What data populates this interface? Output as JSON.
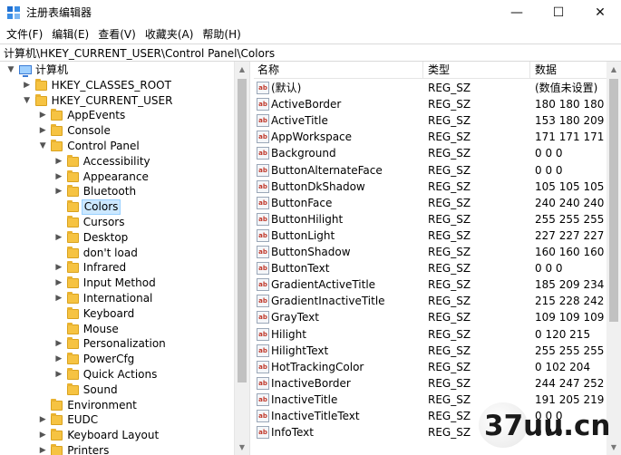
{
  "window": {
    "title": "注册表编辑器",
    "minimize_glyph": "—",
    "maximize_glyph": "☐",
    "close_glyph": "✕"
  },
  "menu": [
    "文件(F)",
    "编辑(E)",
    "查看(V)",
    "收藏夹(A)",
    "帮助(H)"
  ],
  "address": "计算机\\HKEY_CURRENT_USER\\Control Panel\\Colors",
  "tree": {
    "items": [
      {
        "label": "计算机",
        "level": 0,
        "expander": "down",
        "kind": "computer"
      },
      {
        "label": "HKEY_CLASSES_ROOT",
        "level": 1,
        "expander": "right",
        "kind": "folder"
      },
      {
        "label": "HKEY_CURRENT_USER",
        "level": 1,
        "expander": "down",
        "kind": "folder"
      },
      {
        "label": "AppEvents",
        "level": 2,
        "expander": "right",
        "kind": "folder"
      },
      {
        "label": "Console",
        "level": 2,
        "expander": "right",
        "kind": "folder"
      },
      {
        "label": "Control Panel",
        "level": 2,
        "expander": "down",
        "kind": "folder"
      },
      {
        "label": "Accessibility",
        "level": 3,
        "expander": "right",
        "kind": "folder"
      },
      {
        "label": "Appearance",
        "level": 3,
        "expander": "right",
        "kind": "folder"
      },
      {
        "label": "Bluetooth",
        "level": 3,
        "expander": "right",
        "kind": "folder"
      },
      {
        "label": "Colors",
        "level": 3,
        "expander": "none",
        "kind": "folder",
        "selected": true
      },
      {
        "label": "Cursors",
        "level": 3,
        "expander": "none",
        "kind": "folder"
      },
      {
        "label": "Desktop",
        "level": 3,
        "expander": "right",
        "kind": "folder"
      },
      {
        "label": "don't load",
        "level": 3,
        "expander": "none",
        "kind": "folder"
      },
      {
        "label": "Infrared",
        "level": 3,
        "expander": "right",
        "kind": "folder"
      },
      {
        "label": "Input Method",
        "level": 3,
        "expander": "right",
        "kind": "folder"
      },
      {
        "label": "International",
        "level": 3,
        "expander": "right",
        "kind": "folder"
      },
      {
        "label": "Keyboard",
        "level": 3,
        "expander": "none",
        "kind": "folder"
      },
      {
        "label": "Mouse",
        "level": 3,
        "expander": "none",
        "kind": "folder"
      },
      {
        "label": "Personalization",
        "level": 3,
        "expander": "right",
        "kind": "folder"
      },
      {
        "label": "PowerCfg",
        "level": 3,
        "expander": "right",
        "kind": "folder"
      },
      {
        "label": "Quick Actions",
        "level": 3,
        "expander": "right",
        "kind": "folder"
      },
      {
        "label": "Sound",
        "level": 3,
        "expander": "none",
        "kind": "folder"
      },
      {
        "label": "Environment",
        "level": 2,
        "expander": "none",
        "kind": "folder"
      },
      {
        "label": "EUDC",
        "level": 2,
        "expander": "right",
        "kind": "folder"
      },
      {
        "label": "Keyboard Layout",
        "level": 2,
        "expander": "right",
        "kind": "folder"
      },
      {
        "label": "Printers",
        "level": 2,
        "expander": "right",
        "kind": "folder"
      }
    ]
  },
  "list": {
    "headers": {
      "name": "名称",
      "type": "类型",
      "data": "数据"
    },
    "icon_text": "ab",
    "rows": [
      {
        "name": "(默认)",
        "type": "REG_SZ",
        "data": "(数值未设置)"
      },
      {
        "name": "ActiveBorder",
        "type": "REG_SZ",
        "data": "180 180 180"
      },
      {
        "name": "ActiveTitle",
        "type": "REG_SZ",
        "data": "153 180 209"
      },
      {
        "name": "AppWorkspace",
        "type": "REG_SZ",
        "data": "171 171 171"
      },
      {
        "name": "Background",
        "type": "REG_SZ",
        "data": "0 0 0"
      },
      {
        "name": "ButtonAlternateFace",
        "type": "REG_SZ",
        "data": "0 0 0"
      },
      {
        "name": "ButtonDkShadow",
        "type": "REG_SZ",
        "data": "105 105 105"
      },
      {
        "name": "ButtonFace",
        "type": "REG_SZ",
        "data": "240 240 240"
      },
      {
        "name": "ButtonHilight",
        "type": "REG_SZ",
        "data": "255 255 255"
      },
      {
        "name": "ButtonLight",
        "type": "REG_SZ",
        "data": "227 227 227"
      },
      {
        "name": "ButtonShadow",
        "type": "REG_SZ",
        "data": "160 160 160"
      },
      {
        "name": "ButtonText",
        "type": "REG_SZ",
        "data": "0 0 0"
      },
      {
        "name": "GradientActiveTitle",
        "type": "REG_SZ",
        "data": "185 209 234"
      },
      {
        "name": "GradientInactiveTitle",
        "type": "REG_SZ",
        "data": "215 228 242"
      },
      {
        "name": "GrayText",
        "type": "REG_SZ",
        "data": "109 109 109"
      },
      {
        "name": "Hilight",
        "type": "REG_SZ",
        "data": "0 120 215"
      },
      {
        "name": "HilightText",
        "type": "REG_SZ",
        "data": "255 255 255"
      },
      {
        "name": "HotTrackingColor",
        "type": "REG_SZ",
        "data": "0 102 204"
      },
      {
        "name": "InactiveBorder",
        "type": "REG_SZ",
        "data": "244 247 252"
      },
      {
        "name": "InactiveTitle",
        "type": "REG_SZ",
        "data": "191 205 219"
      },
      {
        "name": "InactiveTitleText",
        "type": "REG_SZ",
        "data": "0 0 0"
      },
      {
        "name": "InfoText",
        "type": "REG_SZ",
        "data": "0 0 0"
      }
    ]
  },
  "watermark": {
    "text": "37uu.cn"
  }
}
